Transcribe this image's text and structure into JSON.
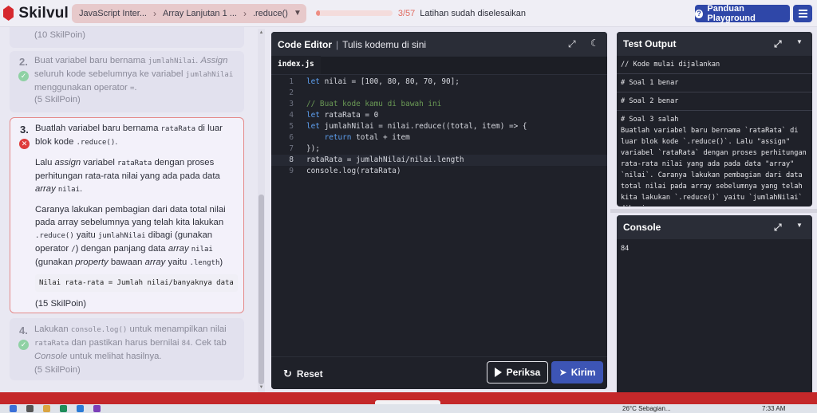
{
  "app": {
    "brand": "Skilvul",
    "breadcrumbs": [
      "JavaScript Inter...",
      "Array Lanjutan 1 ...",
      ".reduce()"
    ],
    "progress": {
      "value": 3,
      "total": 57,
      "label": "3/57",
      "text": "Latihan sudah diselesaikan"
    },
    "guide_button": "Panduan Playground",
    "colors": {
      "accent": "#2f47a8",
      "error": "#de3b3b",
      "success": "#8fd1a4",
      "brand": "#d6282e"
    }
  },
  "instructions": {
    "prev_points": "(10 SkilPoin)",
    "steps": [
      {
        "num": "2.",
        "status": "check-icon",
        "text_a": "Buat variabel baru bernama ",
        "code_a": "jumlahNilai",
        "text_b": ". ",
        "em_b": "Assign",
        "text_c": " seluruh kode sebelumnya ke variabel ",
        "code_c": "jumlahNilai",
        "text_d": " menggunakan operator ",
        "code_d": "=",
        "text_e": ".",
        "points": "(5 SkilPoin)"
      },
      {
        "num": "3.",
        "status": "error-icon",
        "p1_a": "Buatlah variabel baru bernama ",
        "p1_code": "rataRata",
        "p1_b": " di luar blok kode ",
        "p1_code2": ".reduce()",
        "p1_c": ".",
        "p2_a": "Lalu ",
        "p2_em": "assign",
        "p2_b": " variabel ",
        "p2_code": "rataRata",
        "p2_c": " dengan proses perhitungan rata-rata nilai yang ada pada data ",
        "p2_em2": "array",
        "p2_code2": "nilai",
        "p2_d": ".",
        "p3_a": "Caranya lakukan pembagian dari data total nilai pada array sebelumnya yang telah kita lakukan ",
        "p3_code1": ".reduce()",
        "p3_b": " yaitu ",
        "p3_code2": "jumlahNilai",
        "p3_c": " dibagi (gunakan operator ",
        "p3_code3": "/",
        "p3_d": ") dengan panjang data ",
        "p3_em": "array",
        "p3_code4": "nilai",
        "p3_e": " (gunakan ",
        "p3_em2": "property",
        "p3_f": " bawaan ",
        "p3_em3": "array",
        "p3_g": " yaitu ",
        "p3_code5": ".length",
        "p3_h": ")",
        "formula": "Nilai rata-rata = Jumlah nilai/banyaknya data",
        "points": "(15 SkilPoin)"
      },
      {
        "num": "4.",
        "status": "check-icon",
        "a": "Lakukan ",
        "code1": "console.log()",
        "b": " untuk menampilkan nilai ",
        "code2": "rataRata",
        "c": " dan pastikan harus bernilai ",
        "code3": "84",
        "d": ". Cek tab ",
        "em": "Console",
        "e": " untuk melihat hasilnya.",
        "points": "(5 SkilPoin)"
      }
    ]
  },
  "editor": {
    "title": "Code Editor",
    "subtitle": "Tulis kodemu di sini",
    "tab": "index.js",
    "lines": [
      "let nilai = [100, 80, 80, 70, 90];",
      "",
      "// Buat kode kamu di bawah ini",
      "let rataRata = 0",
      "let jumlahNilai = nilai.reduce((total, item) => {",
      "    return total + item",
      "});",
      "rataRata = jumlahNilai/nilai.length",
      "console.log(rataRata)"
    ],
    "line_numbers": [
      "1",
      "2",
      "3",
      "4",
      "5",
      "6",
      "7",
      "8",
      "9"
    ],
    "current_line": 8,
    "reset_label": "Reset",
    "check_label": "Periksa",
    "send_label": "Kirim"
  },
  "test_output": {
    "title": "Test Output",
    "rows": [
      "// Kode mulai dijalankan",
      "# Soal 1 benar",
      "# Soal 2 benar",
      "# Soal 3 salah"
    ],
    "message": "Buatlah variabel baru bernama `rataRata` di luar blok kode `.reduce()`. Lalu \"assign\" variabel `rataRata` dengan proses perhitungan rata-rata nilai yang ada pada data \"array\" `nilai`. Caranya lakukan pembagian dari data total nilai pada array sebelumnya yang telah kita lakukan `.reduce()` yaitu `jumlahNilai` dibagi"
  },
  "console": {
    "title": "Console",
    "output": "84"
  },
  "taskbar": {
    "weather": "26°C Sebagian...",
    "time": "7:33 AM"
  }
}
